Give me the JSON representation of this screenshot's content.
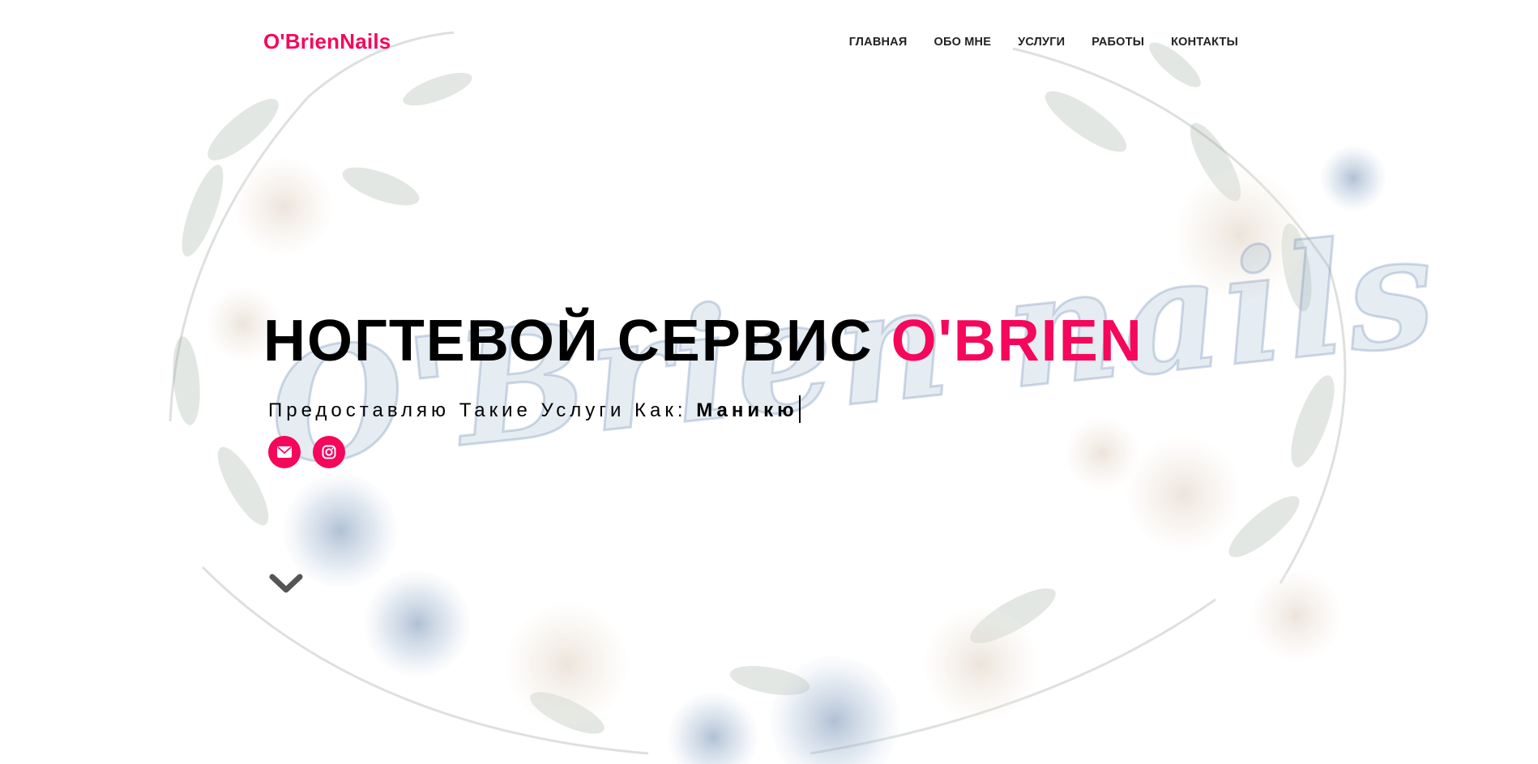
{
  "brand": {
    "logo_text": "O'BrienNails",
    "accent_color": "#f5075b"
  },
  "nav": {
    "items": [
      {
        "label": "ГЛАВНАЯ"
      },
      {
        "label": "ОБО МНЕ"
      },
      {
        "label": "УСЛУГИ"
      },
      {
        "label": "РАБОТЫ"
      },
      {
        "label": "КОНТАКТЫ"
      }
    ]
  },
  "hero": {
    "title_main": "НОГТЕВОЙ СЕРВИС ",
    "title_accent": "O'BRIEN",
    "subtitle_prefix": "Предоставляю Такие Услуги Как: ",
    "subtitle_typed": "Маникю",
    "background_watermark": "O'Brien nails"
  },
  "social": {
    "items": [
      {
        "icon": "envelope-icon"
      },
      {
        "icon": "instagram-icon"
      }
    ]
  },
  "scroll": {
    "icon": "chevron-down-icon"
  }
}
